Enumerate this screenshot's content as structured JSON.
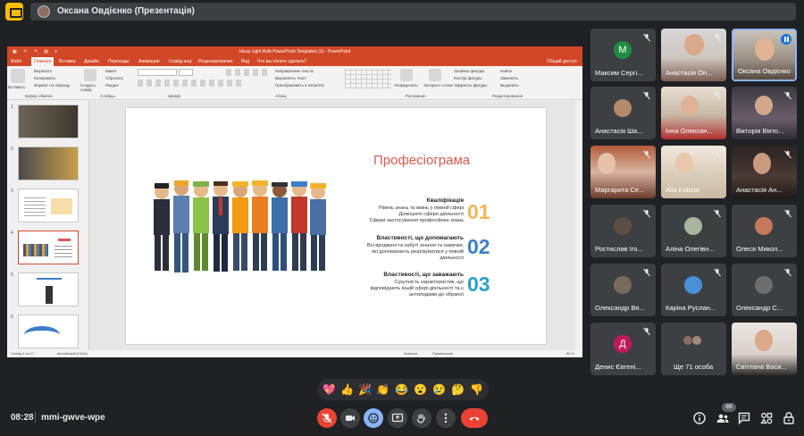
{
  "meeting": {
    "presenter_label": "Оксана Овдієнко (Презентація)",
    "time": "08:28",
    "code": "mmi-gwve-wpe",
    "participants_count_badge": "89"
  },
  "ppt": {
    "window_title": "Ideas Light Bulb PowerPoint Templates (1) - PowerPoint",
    "tabs": [
      "Файл",
      "Главная",
      "Вставка",
      "Дизайн",
      "Переходы",
      "Анимация",
      "Слайд-шоу",
      "Рецензирование",
      "Вид",
      "Что вы хотите сделать?",
      "Общий доступ"
    ],
    "ribbon": {
      "paste": "Вставить",
      "cut": "Вырезать",
      "copy": "Копировать",
      "format_painter": "Формат по образцу",
      "clipboard_group": "Буфер обмена",
      "new_slide": "Создать слайд",
      "layout": "Макет",
      "reset": "Сбросить",
      "section": "Раздел",
      "slides_group": "Слайды",
      "font_group": "Шрифт",
      "text_direction": "Направление текста",
      "align_text": "Выровнять текст",
      "convert_smartart": "Преобразовать в SmartArt",
      "paragraph_group": "Абзац",
      "arrange": "Упорядочить",
      "quick_styles": "Экспресс-стили",
      "shape_fill": "Заливка фигуры",
      "shape_outline": "Контур фигуры",
      "shape_effects": "Эффекты фигуры",
      "drawing_group": "Рисование",
      "find": "Найти",
      "replace": "Заменить",
      "select": "Выделить",
      "editing_group": "Редактирование"
    },
    "thumbnails": [
      "1",
      "2",
      "3",
      "4",
      "5",
      "6"
    ],
    "status": {
      "slide": "Слайд 4 из 17",
      "language": "английский (США)",
      "notes": "Заметки",
      "comments": "Примечания",
      "zoom": "66 %"
    },
    "slide": {
      "title": "Професіограма",
      "items": [
        {
          "number": "01",
          "color": "#f4b55e",
          "heading": "Кваліфікація",
          "lines": [
            "Рівень знань та вмінь у певній сфері",
            "Домінуючі сфери діяльності",
            "Сфери застосування професійних знань"
          ]
        },
        {
          "number": "02",
          "color": "#3d7ec9",
          "heading": "Властивості, що допомагають",
          "lines": [
            "Всі вроджені та набуті знання та навички,",
            "які допомагають реалізуватися у певній",
            "діяльності"
          ]
        },
        {
          "number": "03",
          "color": "#2b9fcf",
          "heading": "Властивості, що заважають",
          "lines": [
            "Сукупність характеристик, що",
            "відповідають іншій сфері діяльності та є",
            "антиподами до обраної"
          ]
        }
      ]
    }
  },
  "participants": [
    {
      "name": "Максим Сергі...",
      "letter": "M",
      "color": "#1e8e3e"
    },
    {
      "name": "Анастасія Оп..."
    },
    {
      "name": "Оксана Овдієнко"
    },
    {
      "name": "Анастасія Ша..."
    },
    {
      "name": "Інна Олексан..."
    },
    {
      "name": "Вікторія Вікто..."
    },
    {
      "name": "Маргарита Се..."
    },
    {
      "name": "Alla Kobzar"
    },
    {
      "name": "Анастасія Ан..."
    },
    {
      "name": "Ростислав Іго..."
    },
    {
      "name": "Аліна Олегівн..."
    },
    {
      "name": "Олеся Микол..."
    },
    {
      "name": "Олександр Вя..."
    },
    {
      "name": "Каріна Руслан..."
    },
    {
      "name": "Олександр С..."
    },
    {
      "name": "Денис Євгені...",
      "letter": "Д",
      "color": "#c2185b"
    },
    {
      "name": "Ще 71 особа"
    },
    {
      "name": "Світлана Васи..."
    }
  ],
  "reactions": [
    "💖",
    "👍",
    "🎉",
    "👏",
    "😂",
    "😮",
    "😢",
    "🤔",
    "👎"
  ],
  "icons": [
    "present-icon",
    "mic-off-icon",
    "camera-icon",
    "emoji-icon",
    "present-screen-icon",
    "raise-hand-icon",
    "more-icon",
    "end-call-icon",
    "info-icon",
    "people-icon",
    "chat-icon",
    "activities-icon",
    "host-controls-icon"
  ]
}
